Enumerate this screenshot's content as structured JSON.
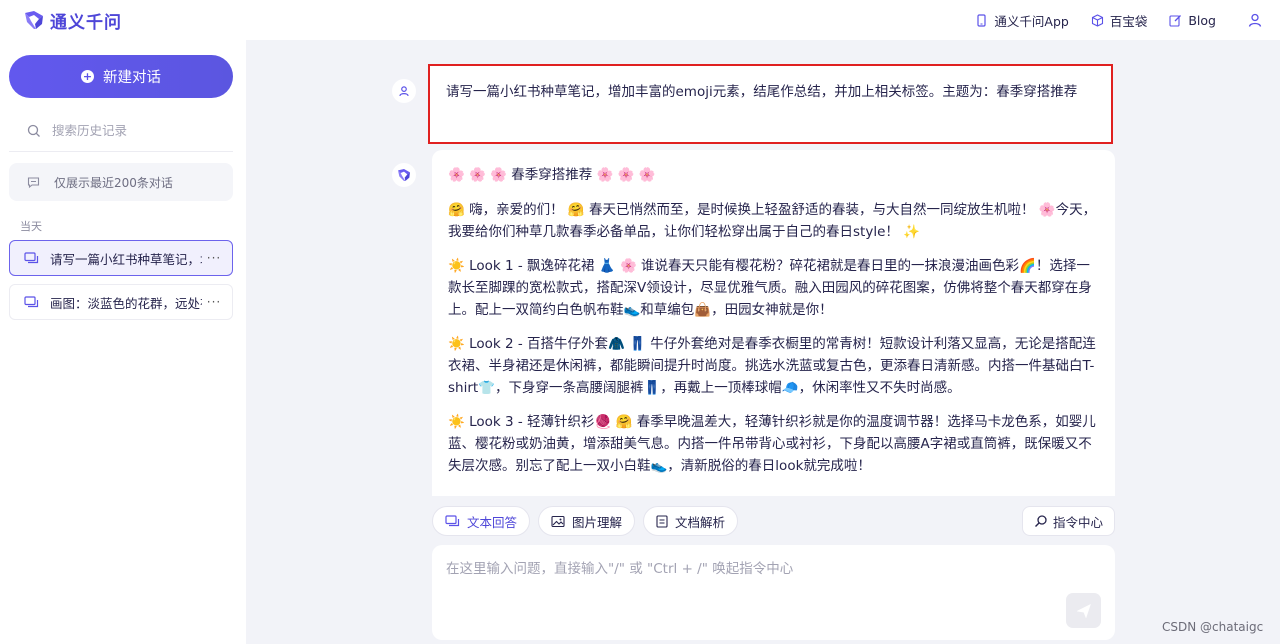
{
  "brand": {
    "name": "通义千问"
  },
  "top_links": [
    {
      "label": "通义千问App",
      "icon": "phone-icon"
    },
    {
      "label": "百宝袋",
      "icon": "cube-icon"
    },
    {
      "label": "Blog",
      "icon": "edit-icon"
    }
  ],
  "sidebar": {
    "new_chat_label": "新建对话",
    "search_placeholder": "搜索历史记录",
    "notice": "仅展示最近200条对话",
    "section_label": "当天",
    "conversations": [
      {
        "title": "请写一篇小红书种草笔记，增加丰富的emoji元素",
        "more": "···",
        "active": true
      },
      {
        "title": "画图：淡蓝色的花群，远处有山",
        "more": "···",
        "active": false
      }
    ]
  },
  "user_message": "请写一篇小红书种草笔记，增加丰富的emoji元素，结尾作总结，并加上相关标签。主题为：春季穿搭推荐",
  "bot_message": {
    "title": "🌸 🌸 🌸 春季穿搭推荐 🌸 🌸 🌸",
    "paragraphs": [
      "🤗 嗨，亲爱的们！ 🤗 春天已悄然而至，是时候换上轻盈舒适的春装，与大自然一同绽放生机啦！ 🌸今天，我要给你们种草几款春季必备单品，让你们轻松穿出属于自己的春日style！ ✨",
      "☀️ Look 1 - 飘逸碎花裙 👗 🌸 谁说春天只能有樱花粉？碎花裙就是春日里的一抹浪漫油画色彩🌈！选择一款长至脚踝的宽松款式，搭配深V领设计，尽显优雅气质。融入田园风的碎花图案，仿佛将整个春天都穿在身上。配上一双简约白色帆布鞋👟和草编包👜，田园女神就是你！",
      "☀️ Look 2 - 百搭牛仔外套🧥 👖 牛仔外套绝对是春季衣橱里的常青树！短款设计利落又显高，无论是搭配连衣裙、半身裙还是休闲裤，都能瞬间提升时尚度。挑选水洗蓝或复古色，更添春日清新感。内搭一件基础白T-shirt👕，下身穿一条高腰阔腿裤👖，再戴上一顶棒球帽🧢，休闲率性又不失时尚感。",
      "☀️ Look 3 - 轻薄针织衫🧶 🤗 春季早晚温差大，轻薄针织衫就是你的温度调节器！选择马卡龙色系，如婴儿蓝、樱花粉或奶油黄，增添甜美气息。内搭一件吊带背心或衬衫，下身配以高腰A字裙或直筒裤，既保暖又不失层次感。别忘了配上一双小白鞋👟，清新脱俗的春日look就完成啦！"
    ]
  },
  "toolbar": {
    "chips": [
      {
        "label": "文本回答",
        "icon": "chat-icon",
        "active": true
      },
      {
        "label": "图片理解",
        "icon": "image-icon",
        "active": false
      },
      {
        "label": "文档解析",
        "icon": "document-icon",
        "active": false
      }
    ],
    "command_center": "指令中心"
  },
  "input": {
    "placeholder": "在这里输入问题，直接输入\"/\" 或 \"Ctrl + /\" 唤起指令中心"
  },
  "watermark": "CSDN @chataigc",
  "colors": {
    "accent": "#5b52e8",
    "highlight_border": "#e02020"
  }
}
